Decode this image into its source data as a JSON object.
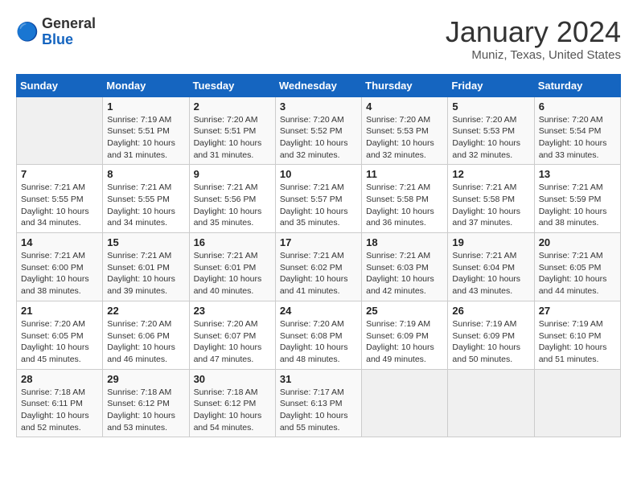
{
  "logo": {
    "text_general": "General",
    "text_blue": "Blue"
  },
  "title": "January 2024",
  "subtitle": "Muniz, Texas, United States",
  "weekdays": [
    "Sunday",
    "Monday",
    "Tuesday",
    "Wednesday",
    "Thursday",
    "Friday",
    "Saturday"
  ],
  "weeks": [
    [
      {
        "day": "",
        "info": ""
      },
      {
        "day": "1",
        "info": "Sunrise: 7:19 AM\nSunset: 5:51 PM\nDaylight: 10 hours\nand 31 minutes."
      },
      {
        "day": "2",
        "info": "Sunrise: 7:20 AM\nSunset: 5:51 PM\nDaylight: 10 hours\nand 31 minutes."
      },
      {
        "day": "3",
        "info": "Sunrise: 7:20 AM\nSunset: 5:52 PM\nDaylight: 10 hours\nand 32 minutes."
      },
      {
        "day": "4",
        "info": "Sunrise: 7:20 AM\nSunset: 5:53 PM\nDaylight: 10 hours\nand 32 minutes."
      },
      {
        "day": "5",
        "info": "Sunrise: 7:20 AM\nSunset: 5:53 PM\nDaylight: 10 hours\nand 32 minutes."
      },
      {
        "day": "6",
        "info": "Sunrise: 7:20 AM\nSunset: 5:54 PM\nDaylight: 10 hours\nand 33 minutes."
      }
    ],
    [
      {
        "day": "7",
        "info": "Sunrise: 7:21 AM\nSunset: 5:55 PM\nDaylight: 10 hours\nand 34 minutes."
      },
      {
        "day": "8",
        "info": "Sunrise: 7:21 AM\nSunset: 5:55 PM\nDaylight: 10 hours\nand 34 minutes."
      },
      {
        "day": "9",
        "info": "Sunrise: 7:21 AM\nSunset: 5:56 PM\nDaylight: 10 hours\nand 35 minutes."
      },
      {
        "day": "10",
        "info": "Sunrise: 7:21 AM\nSunset: 5:57 PM\nDaylight: 10 hours\nand 35 minutes."
      },
      {
        "day": "11",
        "info": "Sunrise: 7:21 AM\nSunset: 5:58 PM\nDaylight: 10 hours\nand 36 minutes."
      },
      {
        "day": "12",
        "info": "Sunrise: 7:21 AM\nSunset: 5:58 PM\nDaylight: 10 hours\nand 37 minutes."
      },
      {
        "day": "13",
        "info": "Sunrise: 7:21 AM\nSunset: 5:59 PM\nDaylight: 10 hours\nand 38 minutes."
      }
    ],
    [
      {
        "day": "14",
        "info": "Sunrise: 7:21 AM\nSunset: 6:00 PM\nDaylight: 10 hours\nand 38 minutes."
      },
      {
        "day": "15",
        "info": "Sunrise: 7:21 AM\nSunset: 6:01 PM\nDaylight: 10 hours\nand 39 minutes."
      },
      {
        "day": "16",
        "info": "Sunrise: 7:21 AM\nSunset: 6:01 PM\nDaylight: 10 hours\nand 40 minutes."
      },
      {
        "day": "17",
        "info": "Sunrise: 7:21 AM\nSunset: 6:02 PM\nDaylight: 10 hours\nand 41 minutes."
      },
      {
        "day": "18",
        "info": "Sunrise: 7:21 AM\nSunset: 6:03 PM\nDaylight: 10 hours\nand 42 minutes."
      },
      {
        "day": "19",
        "info": "Sunrise: 7:21 AM\nSunset: 6:04 PM\nDaylight: 10 hours\nand 43 minutes."
      },
      {
        "day": "20",
        "info": "Sunrise: 7:21 AM\nSunset: 6:05 PM\nDaylight: 10 hours\nand 44 minutes."
      }
    ],
    [
      {
        "day": "21",
        "info": "Sunrise: 7:20 AM\nSunset: 6:05 PM\nDaylight: 10 hours\nand 45 minutes."
      },
      {
        "day": "22",
        "info": "Sunrise: 7:20 AM\nSunset: 6:06 PM\nDaylight: 10 hours\nand 46 minutes."
      },
      {
        "day": "23",
        "info": "Sunrise: 7:20 AM\nSunset: 6:07 PM\nDaylight: 10 hours\nand 47 minutes."
      },
      {
        "day": "24",
        "info": "Sunrise: 7:20 AM\nSunset: 6:08 PM\nDaylight: 10 hours\nand 48 minutes."
      },
      {
        "day": "25",
        "info": "Sunrise: 7:19 AM\nSunset: 6:09 PM\nDaylight: 10 hours\nand 49 minutes."
      },
      {
        "day": "26",
        "info": "Sunrise: 7:19 AM\nSunset: 6:09 PM\nDaylight: 10 hours\nand 50 minutes."
      },
      {
        "day": "27",
        "info": "Sunrise: 7:19 AM\nSunset: 6:10 PM\nDaylight: 10 hours\nand 51 minutes."
      }
    ],
    [
      {
        "day": "28",
        "info": "Sunrise: 7:18 AM\nSunset: 6:11 PM\nDaylight: 10 hours\nand 52 minutes."
      },
      {
        "day": "29",
        "info": "Sunrise: 7:18 AM\nSunset: 6:12 PM\nDaylight: 10 hours\nand 53 minutes."
      },
      {
        "day": "30",
        "info": "Sunrise: 7:18 AM\nSunset: 6:12 PM\nDaylight: 10 hours\nand 54 minutes."
      },
      {
        "day": "31",
        "info": "Sunrise: 7:17 AM\nSunset: 6:13 PM\nDaylight: 10 hours\nand 55 minutes."
      },
      {
        "day": "",
        "info": ""
      },
      {
        "day": "",
        "info": ""
      },
      {
        "day": "",
        "info": ""
      }
    ]
  ]
}
